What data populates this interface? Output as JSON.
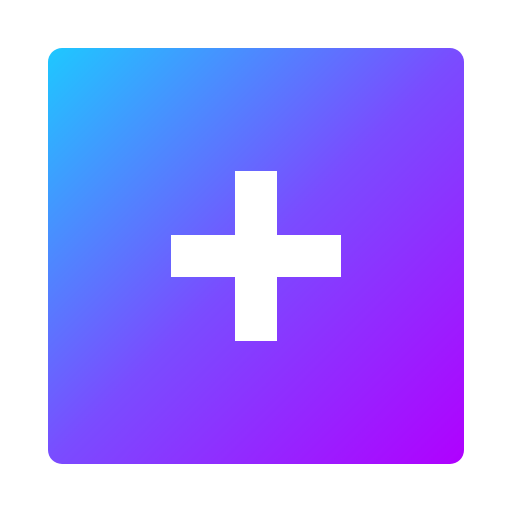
{
  "icon": {
    "name": "plus-icon",
    "colors": {
      "gradient_start": "#1ec8ff",
      "gradient_mid": "#7a4cff",
      "gradient_end": "#b000ff",
      "glyph": "#ffffff"
    }
  }
}
